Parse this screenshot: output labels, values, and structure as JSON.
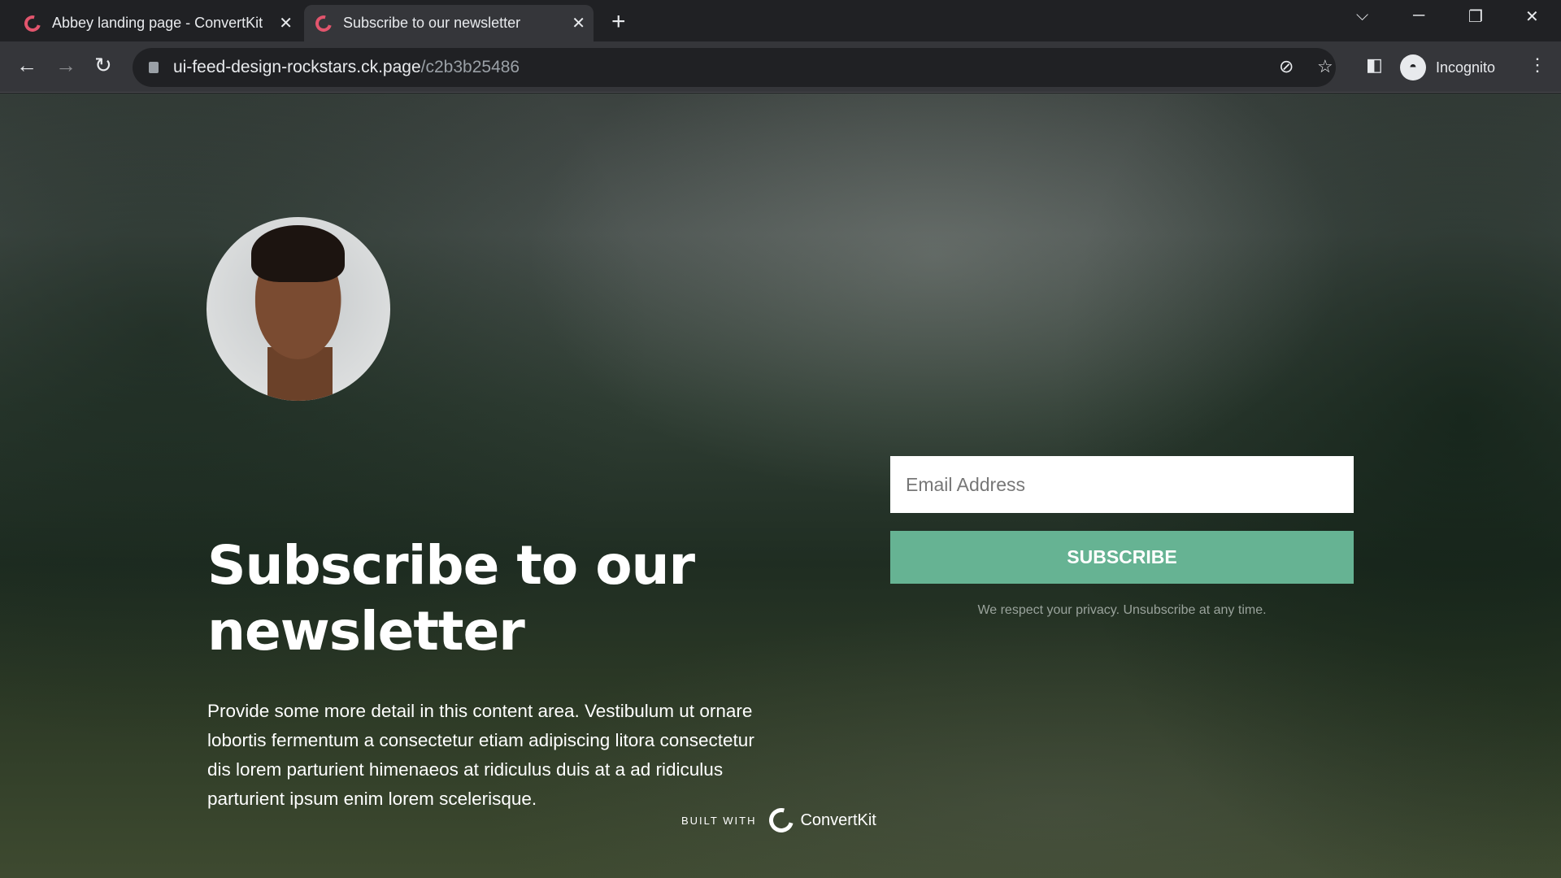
{
  "browser": {
    "tabs": [
      {
        "label": "Abbey landing page - ConvertKit",
        "active": false
      },
      {
        "label": "Subscribe to our newsletter",
        "active": true
      }
    ],
    "url_host": "ui-feed-design-rockstars.ck.page",
    "url_path": "/c2b3b25486",
    "profile_label": "Incognito",
    "favicon_color": "#e2556d"
  },
  "page": {
    "heading": "Subscribe to our newsletter",
    "description": "Provide some more detail in this content area. Vestibulum ut ornare lobortis fermentum a consectetur etiam adipiscing litora consectetur dis lorem parturient himenaeos at ridiculus duis at a ad ridiculus parturient ipsum enim lorem scelerisque.",
    "email_placeholder": "Email Address",
    "email_value": "",
    "subscribe_label": "SUBSCRIBE",
    "button_color": "#66b393",
    "privacy_text": "We respect your privacy. Unsubscribe at any time.",
    "built_with": "BUILT WITH",
    "brand": "ConvertKit"
  }
}
